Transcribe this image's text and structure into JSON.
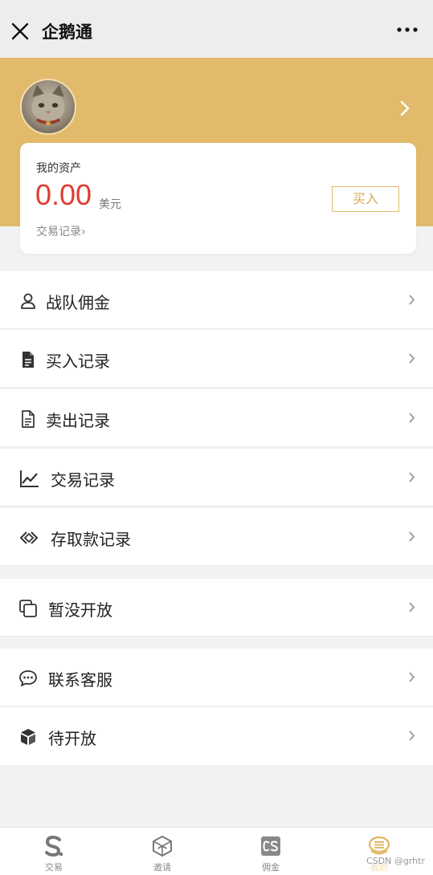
{
  "navbar": {
    "title": "企鹅通",
    "close_icon": "close-icon",
    "more_icon": "more-dots-icon"
  },
  "colors": {
    "gold": "#e2ba6b",
    "red": "#e03c31",
    "bg": "#f1f2f4"
  },
  "assets": {
    "label": "我的资产",
    "amount": "0.00",
    "currency": "美元",
    "tx_link": "交易记录›",
    "buy_label": "买入"
  },
  "menu": [
    {
      "label": "战队佣金",
      "icon": "user-icon"
    },
    {
      "label": "买入记录",
      "icon": "document-filled-icon"
    },
    {
      "label": "卖出记录",
      "icon": "document-outline-icon"
    },
    {
      "label": "交易记录",
      "icon": "line-chart-icon"
    },
    {
      "label": "存取款记录",
      "icon": "transfer-icon"
    },
    {
      "label": "暂没开放",
      "icon": "copy-icon"
    },
    {
      "label": "联系客服",
      "icon": "chat-bubble-icon"
    },
    {
      "label": "待开放",
      "icon": "box-icon"
    }
  ],
  "tabs": [
    {
      "label": "交易",
      "icon": "s-logo-icon"
    },
    {
      "label": "邀请",
      "icon": "cube-icon"
    },
    {
      "label": "佣金",
      "icon": "cs-badge-icon"
    },
    {
      "label": "我的",
      "icon": "coin-stack-icon"
    }
  ],
  "watermark": "CSDN @grhtr"
}
